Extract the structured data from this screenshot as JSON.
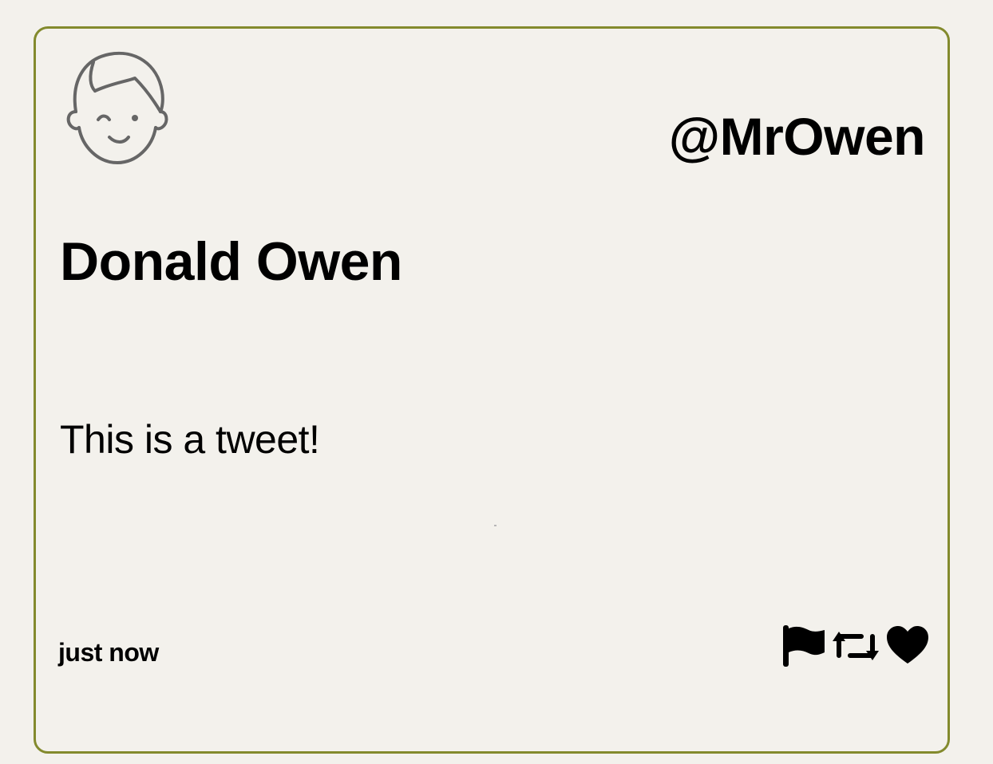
{
  "tweet": {
    "handle": "@MrOwen",
    "display_name": "Donald Owen",
    "text": "This is a tweet!",
    "timestamp": "just now",
    "avatar_icon": "user-face-icon",
    "actions": [
      {
        "icon": "flag-icon",
        "label": "flag"
      },
      {
        "icon": "retweet-icon",
        "label": "retweet"
      },
      {
        "icon": "heart-icon",
        "label": "like"
      }
    ]
  },
  "colors": {
    "background": "#f3f1ec",
    "card_border": "#838a2d",
    "text": "#000000",
    "avatar_stroke": "#666666"
  }
}
